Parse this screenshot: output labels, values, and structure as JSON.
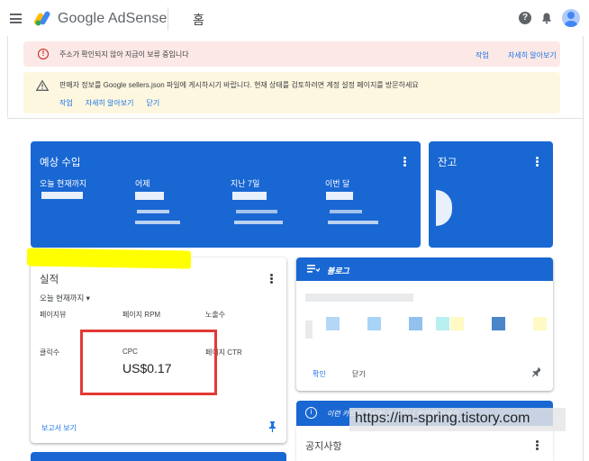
{
  "header": {
    "brand": "Google AdSense",
    "page_title": "홈",
    "help_icon": "help-icon",
    "notifications_icon": "bell-icon",
    "account_icon": "account-icon"
  },
  "alerts": {
    "error": {
      "message": "주소가 확인되지 않아 지급이 보류 중입니다",
      "action_primary": "작업",
      "action_secondary": "자세히 알아보기",
      "color": "#fce8e6"
    },
    "warning": {
      "message": "판매자 정보를 Google sellers.json 파일에 게시하시기 바랍니다. 현재 상태를 검토하려면 계정 설정 페이지를 방문하세요",
      "actions": [
        "작업",
        "자세히 알아보기",
        "닫기"
      ],
      "color": "#fef7e0"
    }
  },
  "earnings": {
    "title": "예상 수입",
    "columns": [
      "오늘 현재까지",
      "어제",
      "지난 7일",
      "이번 달"
    ],
    "color": "#1967d2"
  },
  "balance": {
    "title": "잔고"
  },
  "performance": {
    "title": "실적",
    "range": "오늘 현재까지",
    "metrics": {
      "pageviews_label": "페이지뷰",
      "page_rpm_label": "페이지 RPM",
      "impressions_label": "노출수",
      "clicks_label": "클릭수",
      "cpc_label": "CPC",
      "cpc_value": "US$0.17",
      "page_ctr_label": "페이지 CTR"
    },
    "report_link": "보고서 보기"
  },
  "blogs": {
    "header": "블로그",
    "action_primary": "확인",
    "action_secondary": "닫기"
  },
  "tip_bar": {
    "text": "이런 카드도 표시될 수 있으니 확인해 보세요"
  },
  "notices": {
    "title": "공지사항"
  },
  "watermark": "https://im-spring.tistory.com"
}
